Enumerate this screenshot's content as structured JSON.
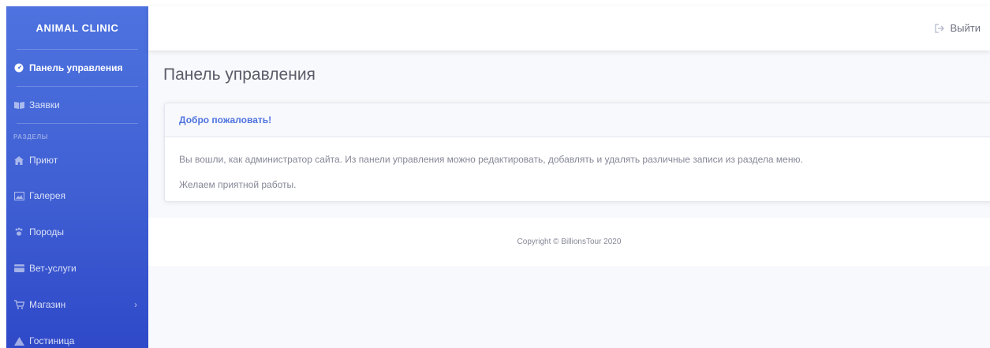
{
  "brand": "ANIMAL CLINIC",
  "sidebar": {
    "items": [
      {
        "label": "Панель управления",
        "icon": "dashboard-icon"
      },
      {
        "label": "Заявки",
        "icon": "book-icon"
      }
    ],
    "section_heading": "РАЗДЕЛЫ",
    "sections": [
      {
        "label": "Приют",
        "icon": "home-icon"
      },
      {
        "label": "Галерея",
        "icon": "gallery-icon"
      },
      {
        "label": "Породы",
        "icon": "paw-icon"
      },
      {
        "label": "Вет-услуги",
        "icon": "card-icon"
      },
      {
        "label": "Магазин",
        "icon": "cart-icon",
        "chevron": "›"
      },
      {
        "label": "Гостиница",
        "icon": "tent-icon"
      }
    ]
  },
  "topbar": {
    "logout_label": "Выйти"
  },
  "main": {
    "title": "Панель управления",
    "card": {
      "header": "Добро пожаловать!",
      "paragraphs": [
        "Вы вошли, как администратор сайта. Из панели управления можно редактировать, добавлять и удалять различные записи из раздела меню.",
        "Желаем приятной работы."
      ]
    }
  },
  "footer": {
    "copyright": "Copyright © BillionsTour 2020"
  },
  "colors": {
    "sidebar_top": "#4e73df",
    "sidebar_bottom": "#2f49c8",
    "accent": "#4e73df",
    "content_bg": "#f8f9fc"
  }
}
